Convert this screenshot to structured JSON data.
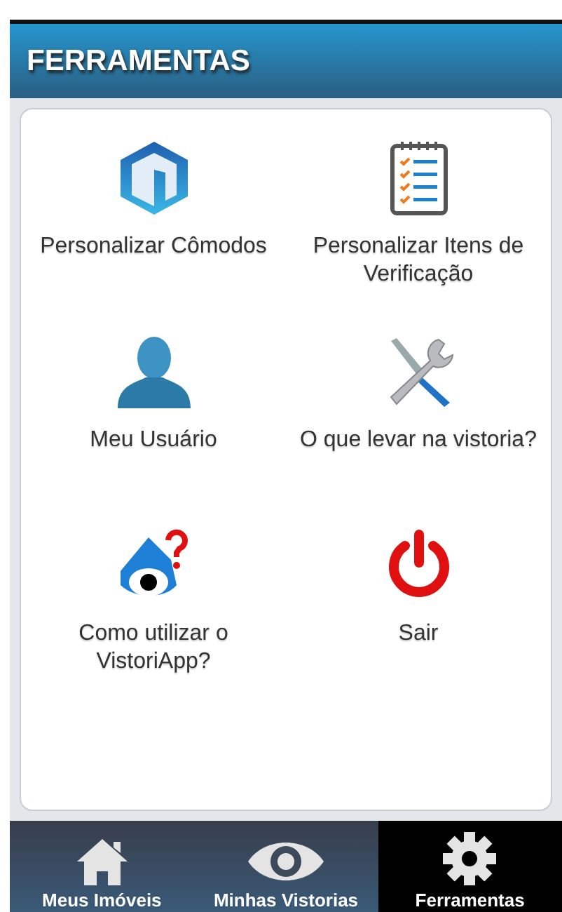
{
  "header": {
    "title": "FERRAMENTAS"
  },
  "tools": [
    {
      "kind": "rooms",
      "label": "Personalizar Cômodos"
    },
    {
      "kind": "checklist",
      "label": "Personalizar Itens de Verificação"
    },
    {
      "kind": "user",
      "label": "Meu Usuário"
    },
    {
      "kind": "tools",
      "label": "O que levar na vistoria?"
    },
    {
      "kind": "help",
      "label": "Como utilizar o VistoriApp?"
    },
    {
      "kind": "power",
      "label": "Sair"
    }
  ],
  "tabs": [
    {
      "kind": "home",
      "label": "Meus Imóveis",
      "selected": false
    },
    {
      "kind": "eye",
      "label": "Minhas Vistorias",
      "selected": false
    },
    {
      "kind": "gear",
      "label": "Ferramentas",
      "selected": true
    }
  ]
}
